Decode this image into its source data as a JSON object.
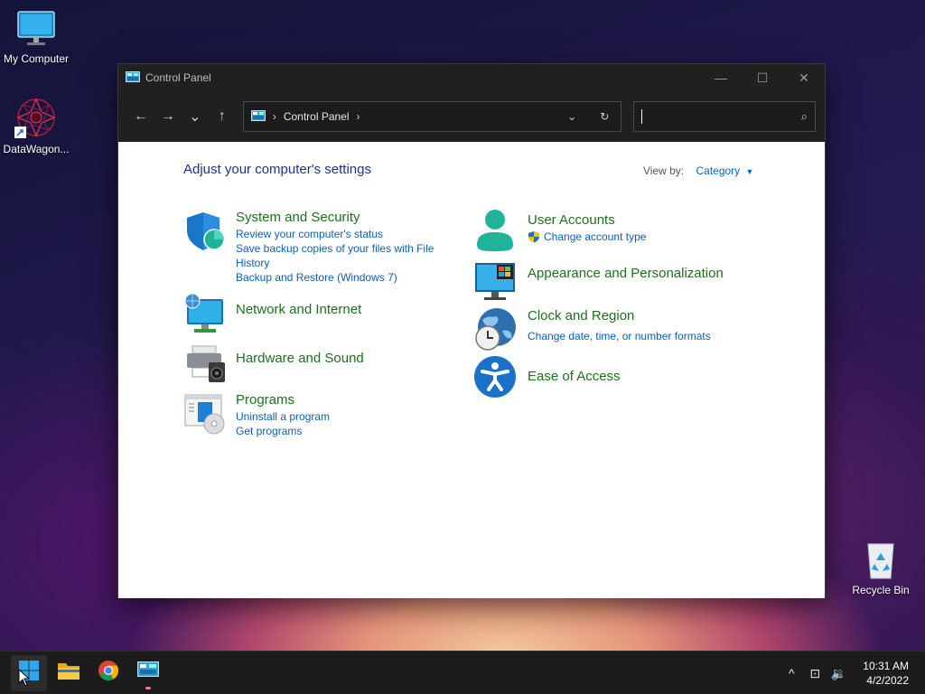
{
  "desktop": {
    "icons": [
      {
        "label": "My Computer",
        "icon": "monitor-icon"
      },
      {
        "label": "DataWagon...",
        "icon": "datawagon-shortcut-icon"
      },
      {
        "label": "Recycle Bin",
        "icon": "recycle-bin-icon"
      }
    ]
  },
  "window": {
    "title": "Control Panel",
    "controls": {
      "minimize": "—",
      "maximize": "☐",
      "close": "✕"
    },
    "nav": {
      "back": "←",
      "forward": "→",
      "recent": "⌄",
      "up": "↑"
    },
    "address": {
      "crumb": "Control Panel",
      "sep": "›",
      "trail_sep": "›",
      "dropdown": "⌄",
      "refresh": "↻"
    },
    "search": {
      "placeholder": "",
      "icon": "⌕"
    }
  },
  "content": {
    "heading": "Adjust your computer's settings",
    "view_by_label": "View by:",
    "view_by_value": "Category",
    "view_by_caret": "▼",
    "categories": [
      {
        "title": "System and Security",
        "links": [
          "Review your computer's status",
          "Save backup copies of your files with File History",
          "Backup and Restore (Windows 7)"
        ]
      },
      {
        "title": "Network and Internet",
        "links": []
      },
      {
        "title": "Hardware and Sound",
        "links": []
      },
      {
        "title": "Programs",
        "links": [
          "Uninstall a program",
          "Get programs"
        ]
      },
      {
        "title": "User Accounts",
        "links": [
          "Change account type"
        ]
      },
      {
        "title": "Appearance and Personalization",
        "links": []
      },
      {
        "title": "Clock and Region",
        "links": [
          "Change date, time, or number formats"
        ]
      },
      {
        "title": "Ease of Access",
        "links": []
      }
    ]
  },
  "taskbar": {
    "apps": [
      {
        "name": "start",
        "icon": "windows-start-icon"
      },
      {
        "name": "file-explorer",
        "icon": "folder-icon"
      },
      {
        "name": "chrome",
        "icon": "chrome-icon"
      },
      {
        "name": "control-panel",
        "icon": "control-panel-icon"
      }
    ],
    "tray": {
      "chevron": "^",
      "network": "⊡",
      "volume": "🔉"
    },
    "time": "10:31 AM",
    "date": "4/2/2022"
  }
}
